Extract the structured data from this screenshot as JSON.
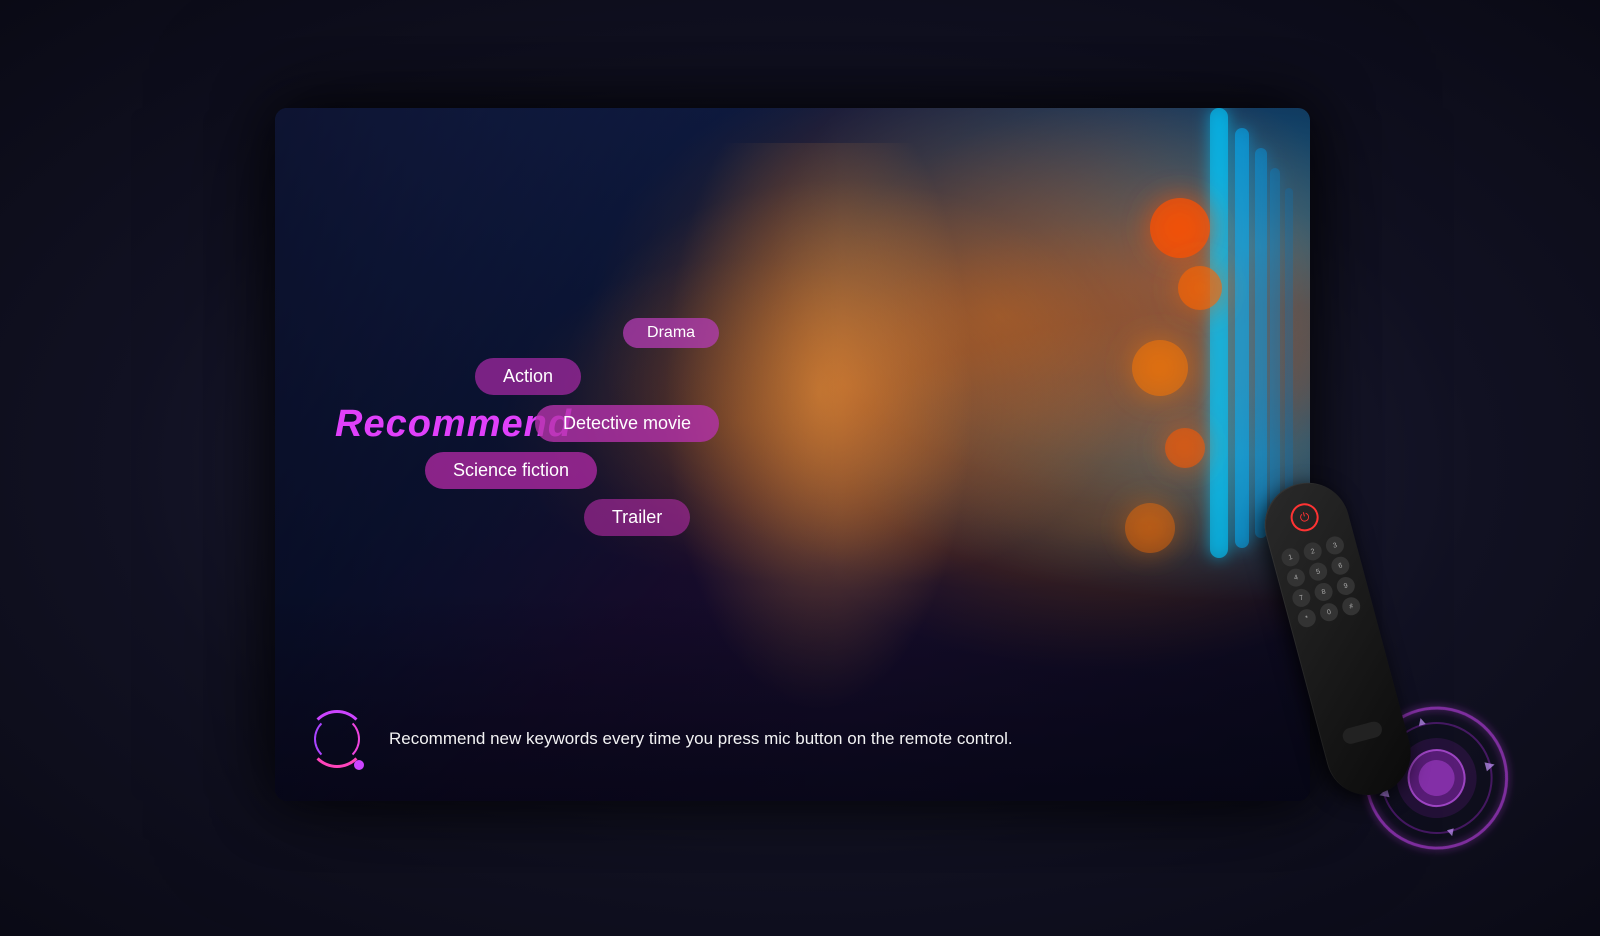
{
  "screen": {
    "recommend_label": "Recommend",
    "voice_text": "Recommend new keywords every time you press mic button on the remote control.",
    "genres": [
      {
        "label": "Drama",
        "class": "drama"
      },
      {
        "label": "Action",
        "class": "action"
      },
      {
        "label": "Detective movie",
        "class": "detective"
      },
      {
        "label": "Science fiction",
        "class": "science-fiction"
      },
      {
        "label": "Trailer",
        "class": "trailer"
      }
    ]
  },
  "colors": {
    "accent": "#e040fb",
    "tag_bg": "rgba(180,50,170,0.78)",
    "bg_dark": "#111122"
  }
}
